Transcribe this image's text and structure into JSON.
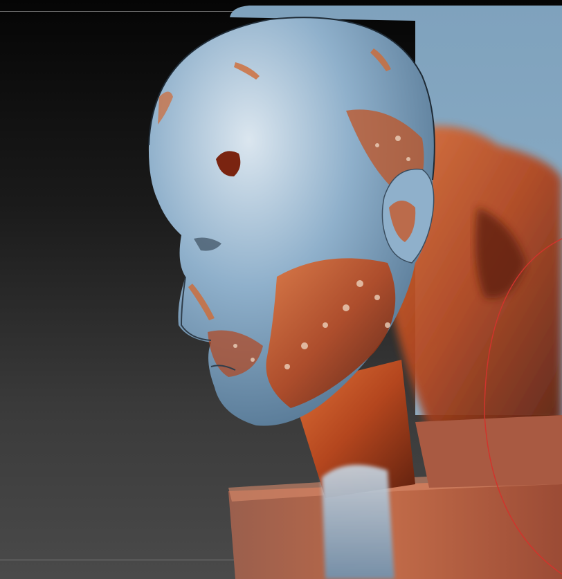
{
  "viewport": {
    "background_top": "#050505",
    "background_bottom": "#4a4a4a",
    "guide_color": "#8a8a8a"
  },
  "model": {
    "primary_color": "#7ea3c2",
    "rust_color": "#b4461e",
    "dark_rust": "#6a2410",
    "highlight": "#dfe9f1"
  },
  "brush_cursor": {
    "color": "#d0342c"
  }
}
